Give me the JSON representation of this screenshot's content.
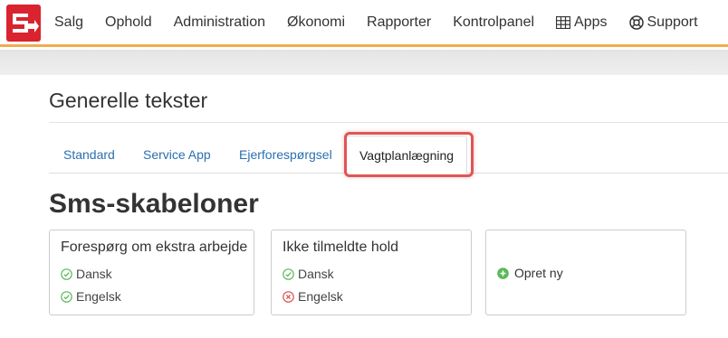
{
  "nav": {
    "items": [
      {
        "label": "Salg"
      },
      {
        "label": "Ophold"
      },
      {
        "label": "Administration"
      },
      {
        "label": "Økonomi"
      },
      {
        "label": "Rapporter"
      },
      {
        "label": "Kontrolpanel"
      },
      {
        "label": "Apps",
        "icon": "grid-icon"
      },
      {
        "label": "Support",
        "icon": "lifebuoy-icon"
      }
    ],
    "accent": "#f0ad4e",
    "logo_color": "#d9232e"
  },
  "page": {
    "title": "Generelle tekster"
  },
  "tabs": [
    {
      "label": "Standard",
      "active": false
    },
    {
      "label": "Service App",
      "active": false
    },
    {
      "label": "Ejerforespørgsel",
      "active": false
    },
    {
      "label": "Vagtplanlægning",
      "active": true
    }
  ],
  "section": {
    "title": "Sms-skabeloner"
  },
  "templates": [
    {
      "title": "Forespørg om ekstra arbejde",
      "languages": [
        {
          "label": "Dansk",
          "status": "ok",
          "icon": "check-circle-icon"
        },
        {
          "label": "Engelsk",
          "status": "ok",
          "icon": "check-circle-icon"
        }
      ]
    },
    {
      "title": "Ikke tilmeldte hold",
      "languages": [
        {
          "label": "Dansk",
          "status": "ok",
          "icon": "check-circle-icon"
        },
        {
          "label": "Engelsk",
          "status": "missing",
          "icon": "x-circle-icon"
        }
      ]
    }
  ],
  "create_new": {
    "label": "Opret ny",
    "icon": "plus-circle-icon"
  },
  "colors": {
    "ok": "#5cb85c",
    "missing": "#d9534f",
    "link": "#2a6fb0",
    "highlight": "#e05555"
  }
}
